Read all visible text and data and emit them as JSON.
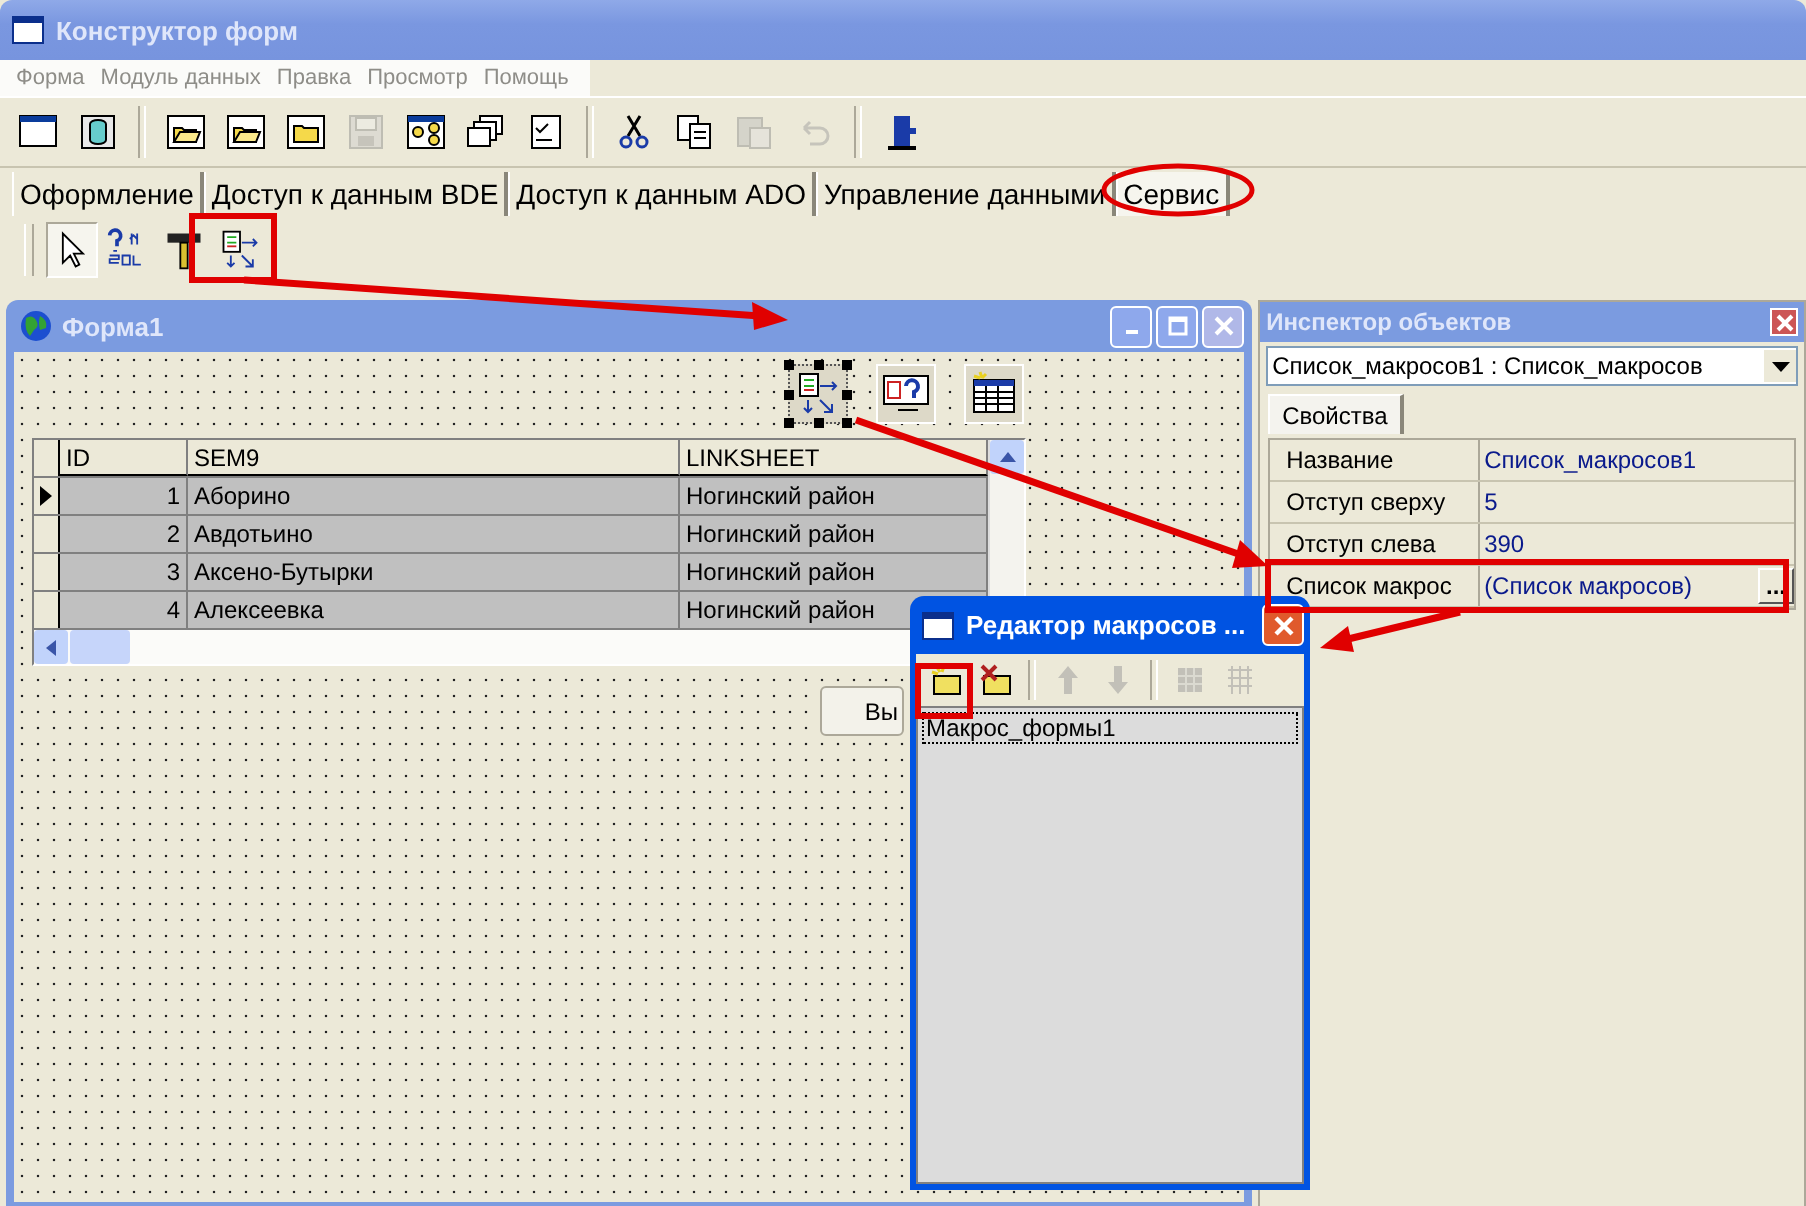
{
  "window": {
    "title": "Конструктор форм"
  },
  "menu": [
    "Форма",
    "Модуль данных",
    "Правка",
    "Просмотр",
    "Помощь"
  ],
  "toolbar": [
    {
      "kind": "window",
      "disabled": false
    },
    {
      "kind": "database",
      "disabled": false
    },
    {
      "kind": "sep"
    },
    {
      "kind": "folder-open",
      "disabled": false
    },
    {
      "kind": "folder-open",
      "disabled": false
    },
    {
      "kind": "folder",
      "disabled": false
    },
    {
      "kind": "save",
      "disabled": true
    },
    {
      "kind": "diagram",
      "disabled": false
    },
    {
      "kind": "windows",
      "disabled": false
    },
    {
      "kind": "checklist",
      "disabled": false
    },
    {
      "kind": "sep"
    },
    {
      "kind": "scissors",
      "disabled": false
    },
    {
      "kind": "copy",
      "disabled": false
    },
    {
      "kind": "paste",
      "disabled": true
    },
    {
      "kind": "undo",
      "disabled": true
    },
    {
      "kind": "sep"
    },
    {
      "kind": "exit",
      "disabled": false
    }
  ],
  "tabs": [
    {
      "label": "Оформление",
      "selected": false
    },
    {
      "label": "Доступ к данным BDE",
      "selected": false
    },
    {
      "label": "Доступ к данным ADO",
      "selected": false
    },
    {
      "label": "Управление данными",
      "selected": false
    },
    {
      "label": "Сервис",
      "selected": true
    }
  ],
  "palette": [
    {
      "kind": "pointer",
      "selected": true
    },
    {
      "kind": "sql-query",
      "selected": false
    },
    {
      "kind": "hammer",
      "selected": false
    },
    {
      "kind": "macro-list",
      "selected": false
    }
  ],
  "form": {
    "title": "Форма1",
    "components": [
      {
        "kind": "macro-list",
        "selected": true
      },
      {
        "kind": "sql-query",
        "selected": false
      },
      {
        "kind": "table",
        "selected": false
      }
    ],
    "grid": {
      "columns": [
        "ID",
        "SEM9",
        "LINKSHEET"
      ],
      "rows": [
        {
          "id": "1",
          "sem9": "Аборино",
          "linksheet": "Ногинский район",
          "current": true
        },
        {
          "id": "2",
          "sem9": "Авдотьино",
          "linksheet": "Ногинский район",
          "current": false
        },
        {
          "id": "3",
          "sem9": "Аксено-Бутырки",
          "linksheet": "Ногинский район",
          "current": false
        },
        {
          "id": "4",
          "sem9": "Алексеевка",
          "linksheet": "Ногинский район",
          "current": false
        }
      ]
    },
    "button": "Вы"
  },
  "inspector": {
    "title": "Инспектор объектов",
    "object": "Список_макросов1 : Список_макросов",
    "tab": "Свойства",
    "properties": [
      {
        "name": "Название",
        "value": "Список_макросов1"
      },
      {
        "name": "Отступ сверху",
        "value": "5"
      },
      {
        "name": "Отступ слева",
        "value": "390"
      },
      {
        "name": "Список макрос",
        "value": "(Список макросов)",
        "ellipsis": "..."
      }
    ]
  },
  "macro_editor": {
    "title": "Редактор макросов ...",
    "tools": [
      {
        "kind": "add",
        "disabled": false
      },
      {
        "kind": "delete",
        "disabled": false
      },
      {
        "kind": "sep"
      },
      {
        "kind": "up",
        "disabled": true
      },
      {
        "kind": "down",
        "disabled": true
      },
      {
        "kind": "sep"
      },
      {
        "kind": "grid-fill",
        "disabled": true
      },
      {
        "kind": "grid",
        "disabled": true
      }
    ],
    "items": [
      {
        "label": "Макрос_формы1",
        "selected": true
      }
    ]
  }
}
